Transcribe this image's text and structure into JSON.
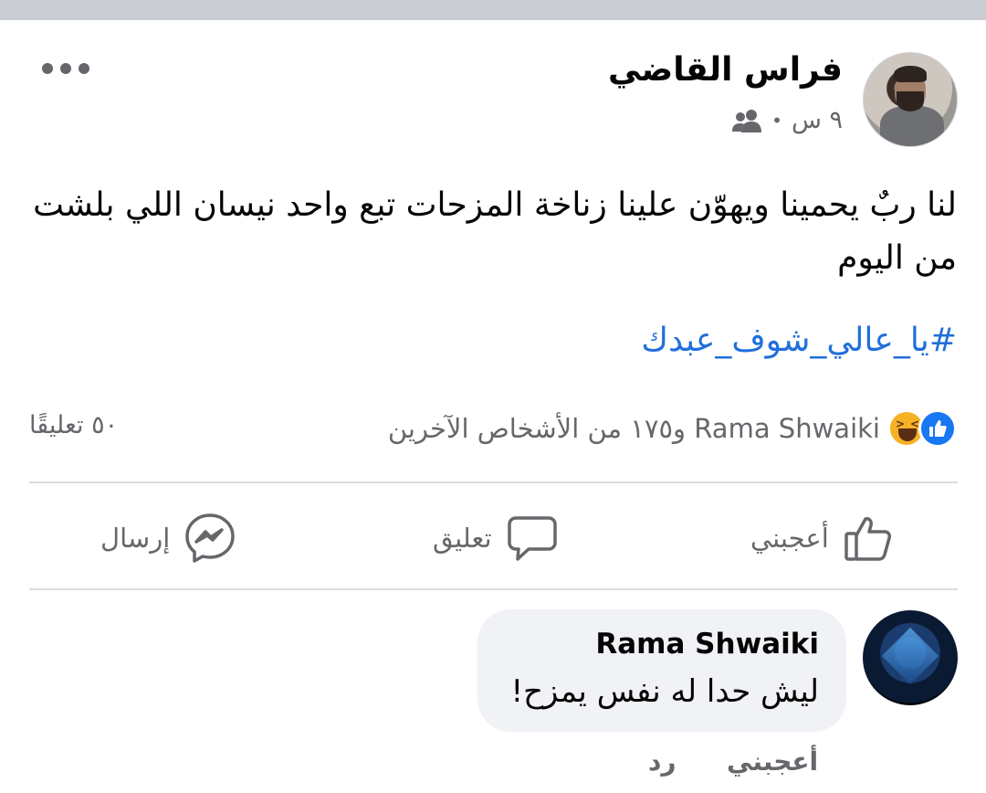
{
  "post": {
    "author": "فراس القاضي",
    "time": "٩ س",
    "audience_icon": "friends-icon",
    "text": "لنا ربٌ يحمينا ويهوّن علينا زناخة المزحات تبع واحد نيسان اللي بلشت من اليوم",
    "hashtag": "#يا_عالي_شوف_عبدك"
  },
  "reactions": {
    "icons": [
      "like-icon",
      "haha-icon"
    ],
    "summary": "Rama Shwaiki و١٧٥ من الأشخاص الآخرين",
    "comments_count": "٥٠ تعليقًا"
  },
  "actions": {
    "like": "أعجبني",
    "comment": "تعليق",
    "send": "إرسال"
  },
  "comment": {
    "author": "Rama Shwaiki",
    "text": "ليش حدا له نفس يمزح!",
    "like": "أعجبني",
    "reply": "رد"
  },
  "colors": {
    "link": "#216fdb",
    "like_blue": "#1877f2",
    "secondary_text": "#65676b",
    "bubble_bg": "#f0f2f5"
  }
}
